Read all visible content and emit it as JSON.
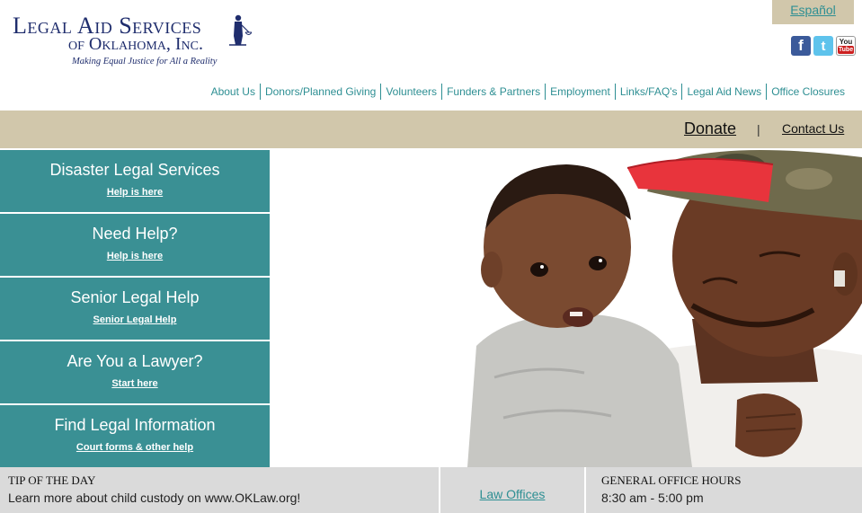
{
  "header": {
    "logo_line1": "Legal Aid Services",
    "logo_line2": "of Oklahoma, Inc.",
    "tagline": "Making Equal Justice for All a Reality",
    "espanol": "Español",
    "social": [
      "facebook-icon",
      "twitter-icon",
      "youtube-icon"
    ]
  },
  "nav": {
    "items": [
      "About Us",
      "Donors/Planned Giving",
      "Volunteers",
      "Funders & Partners",
      "Employment",
      "Links/FAQ's",
      "Legal Aid News",
      "Office Closures"
    ]
  },
  "tanbar": {
    "donate": "Donate",
    "separator": "|",
    "contact": "Contact Us"
  },
  "menu": {
    "items": [
      {
        "title": "Disaster Legal Services",
        "link": "Help is here"
      },
      {
        "title": "Need Help?",
        "link": "Help is here"
      },
      {
        "title": "Senior Legal Help",
        "link": "Senior Legal Help"
      },
      {
        "title": "Are You a Lawyer?",
        "link": "Start here"
      },
      {
        "title": "Find Legal Information",
        "link": "Court forms & other help"
      }
    ]
  },
  "footer": {
    "tip_heading": "TIP OF THE DAY",
    "tip_text": "Learn more about child custody on www.OKLaw.org!",
    "law_offices": "Law Offices",
    "hours_heading": "GENERAL OFFICE HOURS",
    "hours_text": "8:30 am - 5:00 pm"
  },
  "colors": {
    "teal": "#3a9094",
    "tan": "#d1c7ab",
    "navy": "#1f2d6d",
    "gray": "#dadada"
  }
}
